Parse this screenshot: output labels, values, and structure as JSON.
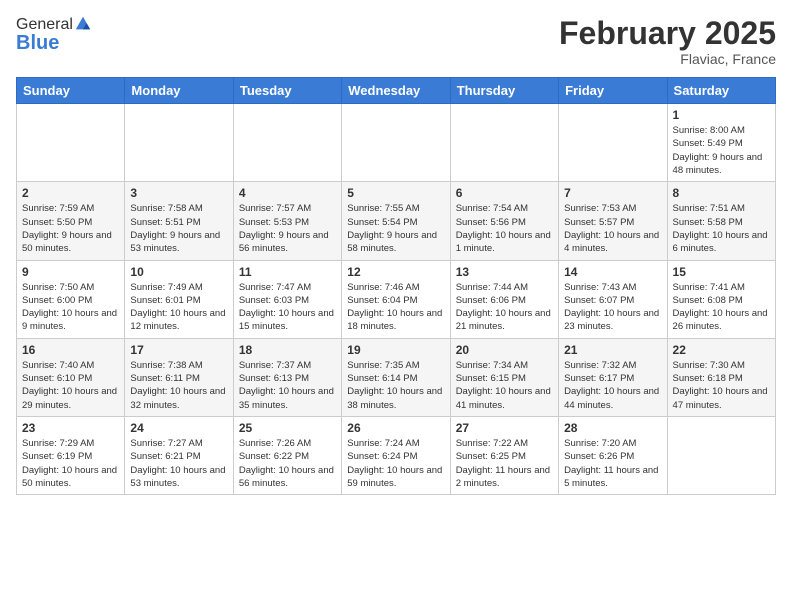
{
  "header": {
    "logo_general": "General",
    "logo_blue": "Blue",
    "month_title": "February 2025",
    "location": "Flaviac, France"
  },
  "weekdays": [
    "Sunday",
    "Monday",
    "Tuesday",
    "Wednesday",
    "Thursday",
    "Friday",
    "Saturday"
  ],
  "weeks": [
    [
      {
        "day": "",
        "info": ""
      },
      {
        "day": "",
        "info": ""
      },
      {
        "day": "",
        "info": ""
      },
      {
        "day": "",
        "info": ""
      },
      {
        "day": "",
        "info": ""
      },
      {
        "day": "",
        "info": ""
      },
      {
        "day": "1",
        "info": "Sunrise: 8:00 AM\nSunset: 5:49 PM\nDaylight: 9 hours and 48 minutes."
      }
    ],
    [
      {
        "day": "2",
        "info": "Sunrise: 7:59 AM\nSunset: 5:50 PM\nDaylight: 9 hours and 50 minutes."
      },
      {
        "day": "3",
        "info": "Sunrise: 7:58 AM\nSunset: 5:51 PM\nDaylight: 9 hours and 53 minutes."
      },
      {
        "day": "4",
        "info": "Sunrise: 7:57 AM\nSunset: 5:53 PM\nDaylight: 9 hours and 56 minutes."
      },
      {
        "day": "5",
        "info": "Sunrise: 7:55 AM\nSunset: 5:54 PM\nDaylight: 9 hours and 58 minutes."
      },
      {
        "day": "6",
        "info": "Sunrise: 7:54 AM\nSunset: 5:56 PM\nDaylight: 10 hours and 1 minute."
      },
      {
        "day": "7",
        "info": "Sunrise: 7:53 AM\nSunset: 5:57 PM\nDaylight: 10 hours and 4 minutes."
      },
      {
        "day": "8",
        "info": "Sunrise: 7:51 AM\nSunset: 5:58 PM\nDaylight: 10 hours and 6 minutes."
      }
    ],
    [
      {
        "day": "9",
        "info": "Sunrise: 7:50 AM\nSunset: 6:00 PM\nDaylight: 10 hours and 9 minutes."
      },
      {
        "day": "10",
        "info": "Sunrise: 7:49 AM\nSunset: 6:01 PM\nDaylight: 10 hours and 12 minutes."
      },
      {
        "day": "11",
        "info": "Sunrise: 7:47 AM\nSunset: 6:03 PM\nDaylight: 10 hours and 15 minutes."
      },
      {
        "day": "12",
        "info": "Sunrise: 7:46 AM\nSunset: 6:04 PM\nDaylight: 10 hours and 18 minutes."
      },
      {
        "day": "13",
        "info": "Sunrise: 7:44 AM\nSunset: 6:06 PM\nDaylight: 10 hours and 21 minutes."
      },
      {
        "day": "14",
        "info": "Sunrise: 7:43 AM\nSunset: 6:07 PM\nDaylight: 10 hours and 23 minutes."
      },
      {
        "day": "15",
        "info": "Sunrise: 7:41 AM\nSunset: 6:08 PM\nDaylight: 10 hours and 26 minutes."
      }
    ],
    [
      {
        "day": "16",
        "info": "Sunrise: 7:40 AM\nSunset: 6:10 PM\nDaylight: 10 hours and 29 minutes."
      },
      {
        "day": "17",
        "info": "Sunrise: 7:38 AM\nSunset: 6:11 PM\nDaylight: 10 hours and 32 minutes."
      },
      {
        "day": "18",
        "info": "Sunrise: 7:37 AM\nSunset: 6:13 PM\nDaylight: 10 hours and 35 minutes."
      },
      {
        "day": "19",
        "info": "Sunrise: 7:35 AM\nSunset: 6:14 PM\nDaylight: 10 hours and 38 minutes."
      },
      {
        "day": "20",
        "info": "Sunrise: 7:34 AM\nSunset: 6:15 PM\nDaylight: 10 hours and 41 minutes."
      },
      {
        "day": "21",
        "info": "Sunrise: 7:32 AM\nSunset: 6:17 PM\nDaylight: 10 hours and 44 minutes."
      },
      {
        "day": "22",
        "info": "Sunrise: 7:30 AM\nSunset: 6:18 PM\nDaylight: 10 hours and 47 minutes."
      }
    ],
    [
      {
        "day": "23",
        "info": "Sunrise: 7:29 AM\nSunset: 6:19 PM\nDaylight: 10 hours and 50 minutes."
      },
      {
        "day": "24",
        "info": "Sunrise: 7:27 AM\nSunset: 6:21 PM\nDaylight: 10 hours and 53 minutes."
      },
      {
        "day": "25",
        "info": "Sunrise: 7:26 AM\nSunset: 6:22 PM\nDaylight: 10 hours and 56 minutes."
      },
      {
        "day": "26",
        "info": "Sunrise: 7:24 AM\nSunset: 6:24 PM\nDaylight: 10 hours and 59 minutes."
      },
      {
        "day": "27",
        "info": "Sunrise: 7:22 AM\nSunset: 6:25 PM\nDaylight: 11 hours and 2 minutes."
      },
      {
        "day": "28",
        "info": "Sunrise: 7:20 AM\nSunset: 6:26 PM\nDaylight: 11 hours and 5 minutes."
      },
      {
        "day": "",
        "info": ""
      }
    ]
  ]
}
